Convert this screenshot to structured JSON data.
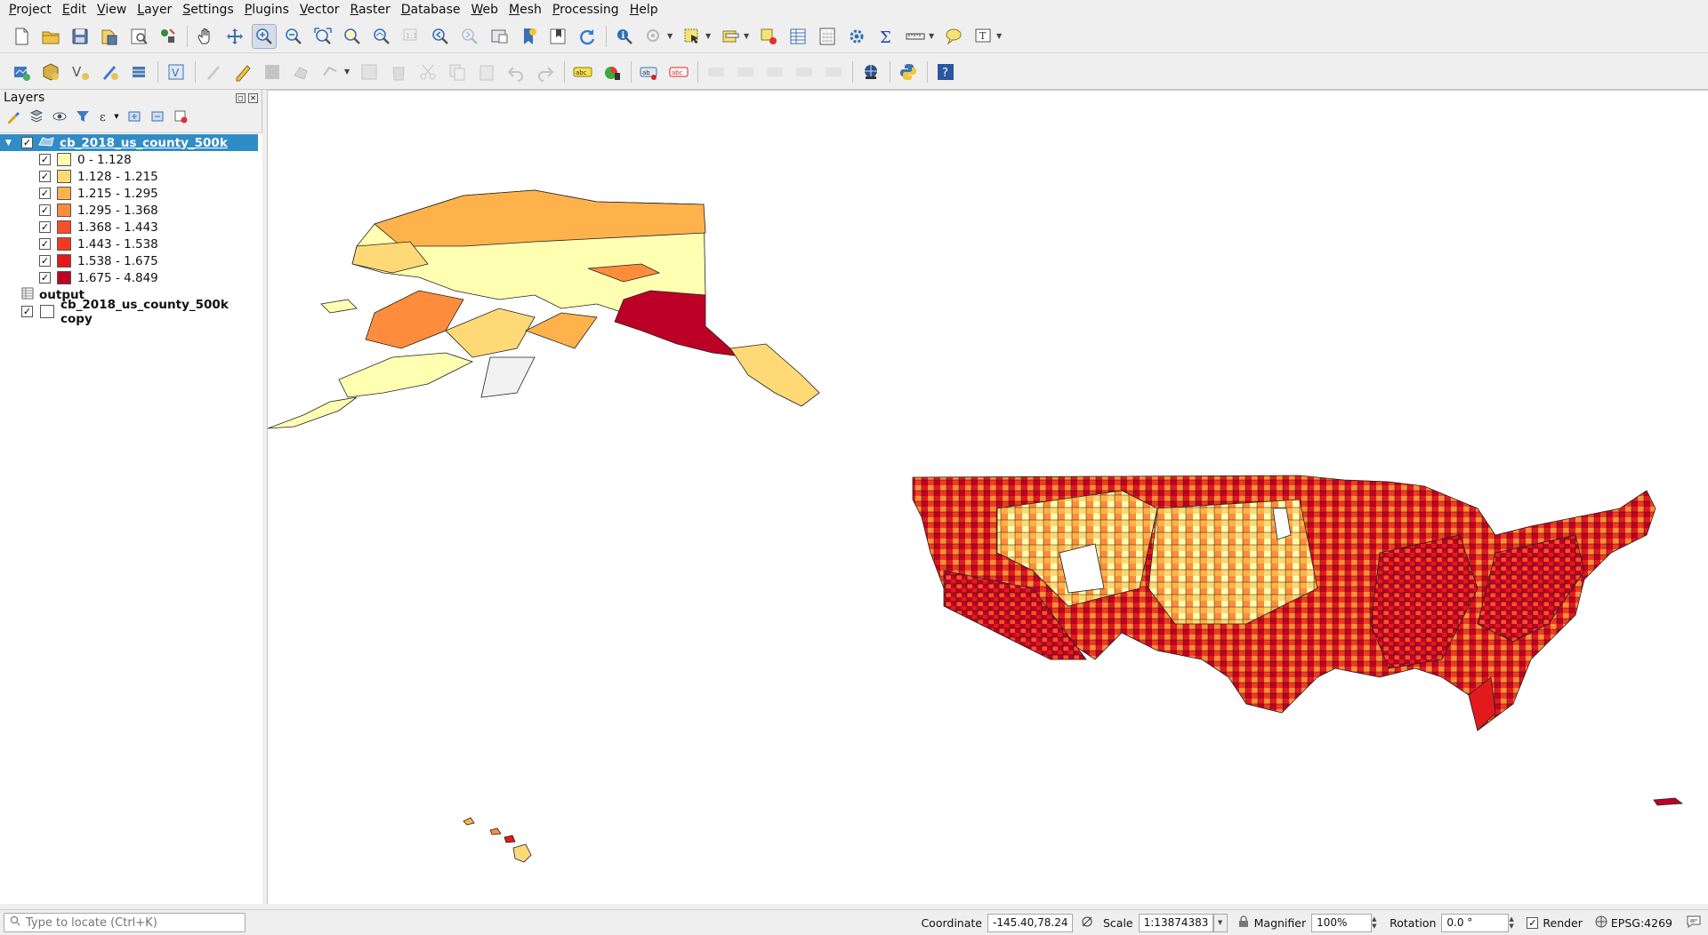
{
  "menu": [
    "Project",
    "Edit",
    "View",
    "Layer",
    "Settings",
    "Plugins",
    "Vector",
    "Raster",
    "Database",
    "Web",
    "Mesh",
    "Processing",
    "Help"
  ],
  "toolbar1": {
    "icons": [
      "new-project-icon",
      "open-project-icon",
      "save-project-icon",
      "save-as-icon",
      "print-layout-icon",
      "style-manager-icon",
      "pan-icon",
      "pan-to-selection-icon",
      "zoom-in-icon",
      "zoom-out-icon",
      "zoom-full-icon",
      "zoom-to-selection-icon",
      "zoom-to-layer-icon",
      "zoom-native-icon",
      "zoom-last-icon",
      "zoom-next-icon",
      "new-map-view-icon",
      "new-bookmark-icon",
      "show-bookmarks-icon",
      "refresh-icon",
      "identify-icon",
      "run-action-icon",
      "select-features-icon",
      "select-by-value-icon",
      "deselect-icon",
      "attribute-table-icon",
      "field-calculator-icon",
      "processing-toolbox-icon",
      "statistics-icon",
      "measure-icon",
      "map-tips-icon",
      "text-annotation-icon"
    ]
  },
  "toolbar2": {
    "icons": [
      "data-source-manager-icon",
      "new-geopackage-layer-icon",
      "new-shapefile-layer-icon",
      "new-temporary-layer-icon",
      "new-spatialite-layer-icon",
      "new-virtual-layer-icon",
      "current-edits-icon",
      "toggle-editing-icon",
      "save-edits-icon",
      "digitize-icon",
      "vertex-tool-icon",
      "modify-attributes-icon",
      "delete-selected-icon",
      "cut-features-icon",
      "copy-features-icon",
      "paste-features-icon",
      "undo-icon",
      "redo-icon",
      "label-tool-icon",
      "diagram-tool-icon",
      "highlight-pinned-labels-icon",
      "pin-labels-icon",
      "show-hide-labels-icon",
      "move-label-icon",
      "rotate-label-icon",
      "change-label-icon",
      "metasearch-icon",
      "python-console-icon",
      "help-icon"
    ]
  },
  "layers_panel": {
    "title": "Layers",
    "layers": [
      {
        "name": "cb_2018_us_county_500k",
        "checked": true,
        "selected": true,
        "classes": [
          {
            "label": "0 - 1.128",
            "color": "#ffffb2",
            "checked": true
          },
          {
            "label": "1.128 - 1.215",
            "color": "#fed976",
            "checked": true
          },
          {
            "label": "1.215 - 1.295",
            "color": "#feb24c",
            "checked": true
          },
          {
            "label": "1.295 - 1.368",
            "color": "#fd8d3c",
            "checked": true
          },
          {
            "label": "1.368 - 1.443",
            "color": "#fc4e2a",
            "checked": true
          },
          {
            "label": "1.443 - 1.538",
            "color": "#f03b20",
            "checked": true
          },
          {
            "label": "1.538 - 1.675",
            "color": "#e31a1c",
            "checked": true
          },
          {
            "label": "1.675 - 4.849",
            "color": "#bd0026",
            "checked": true
          }
        ]
      },
      {
        "name": "output",
        "type": "table"
      },
      {
        "name": "cb_2018_us_county_500k copy",
        "checked": true,
        "fill": "#ffffff"
      }
    ]
  },
  "statusbar": {
    "locator_placeholder": "Type to locate (Ctrl+K)",
    "coordinate_label": "Coordinate",
    "coordinate_value": "-145.40,78.24",
    "scale_label": "Scale",
    "scale_value": "1:13874383",
    "magnifier_label": "Magnifier",
    "magnifier_value": "100%",
    "rotation_label": "Rotation",
    "rotation_value": "0.0 °",
    "render_label": "Render",
    "render_checked": true,
    "crs": "EPSG:4269"
  }
}
